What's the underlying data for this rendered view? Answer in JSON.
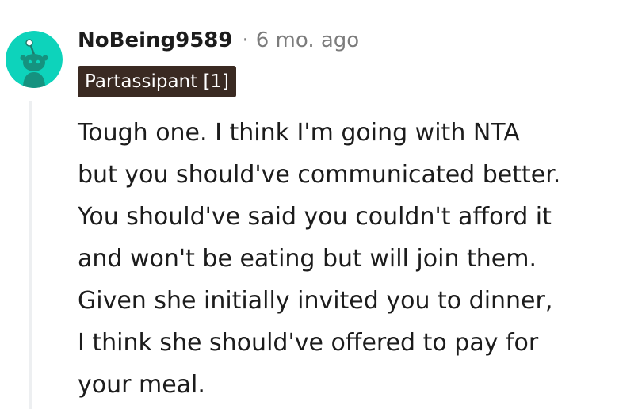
{
  "comment": {
    "username": "NoBeing9589",
    "separator": "·",
    "timestamp": "6 mo. ago",
    "flair": "Partassipant [1]",
    "avatar_icon": "snoo-avatar-icon",
    "body_lines": [
      "Tough one. I think I'm going with NTA",
      "but you should've communicated better.",
      "You should've said you couldn't afford it",
      "and won't be eating but will join them.",
      "Given she initially invited you to dinner,",
      "I think she should've offered to pay for",
      "your meal."
    ]
  },
  "colors": {
    "avatar_bg": "#0dd3bb",
    "flair_bg": "#3a2a22",
    "text": "#1c1c1c",
    "meta_text": "#7c7c7c",
    "thread_line": "#edeff1"
  }
}
